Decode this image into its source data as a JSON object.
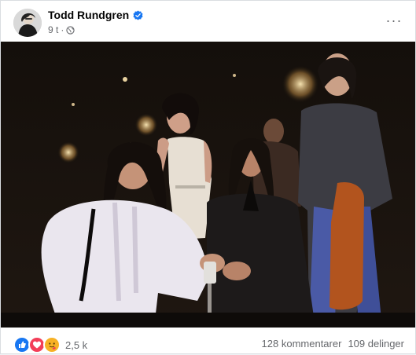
{
  "post": {
    "author": "Todd Rundgren",
    "time": "9 t",
    "separator": "·",
    "more_label": "···"
  },
  "icons": {
    "verified": "verified-badge-icon",
    "audience": "globe-icon",
    "more": "more-horizontal-icon",
    "reactions": [
      "like-icon",
      "love-icon",
      "care-icon"
    ]
  },
  "colors": {
    "verified": "#1877f2",
    "like": "#1877f2",
    "love": "#f33e58",
    "care": "#f7b125",
    "secondary_text": "#65676b"
  },
  "engagement": {
    "reaction_count": "2,5 k",
    "comments": "128 kommentarer",
    "shares": "109 delinger"
  }
}
